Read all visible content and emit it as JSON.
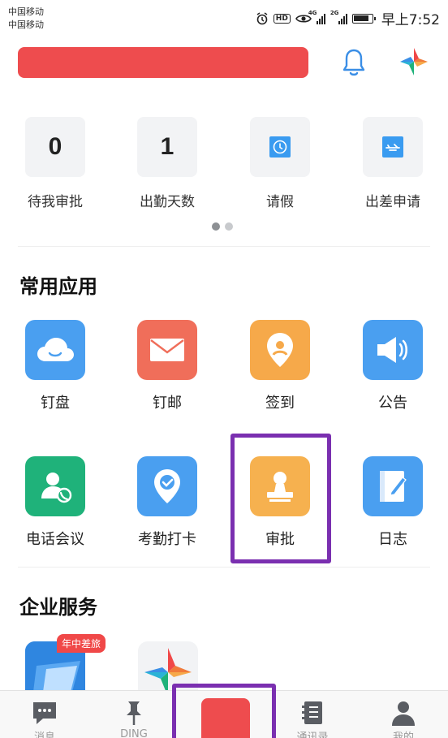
{
  "status_bar": {
    "carrier_1": "中国移动",
    "carrier_2": "中国移动",
    "hd_label": "HD",
    "net_1": "4G",
    "net_2": "2G",
    "time": "早上7:52"
  },
  "header": {
    "banner_color": "#ee4c4e",
    "bell_icon": "bell-icon",
    "logo_icon": "dingtalk-star-logo-icon"
  },
  "quick_stats": [
    {
      "value": "0",
      "label": "待我审批"
    },
    {
      "value": "1",
      "label": "出勤天数"
    },
    {
      "icon": "clock-icon",
      "label": "请假"
    },
    {
      "icon": "airplane-icon",
      "label": "出差申请"
    }
  ],
  "pager": {
    "total": 2,
    "active": 1
  },
  "common_apps": {
    "title": "常用应用",
    "items": [
      {
        "label": "钉盘",
        "icon": "cloud-icon",
        "color": "#4a9ff0"
      },
      {
        "label": "钉邮",
        "icon": "mail-icon",
        "color": "#f06e5a"
      },
      {
        "label": "签到",
        "icon": "location-pin-icon",
        "color": "#f6a94a"
      },
      {
        "label": "公告",
        "icon": "megaphone-icon",
        "color": "#4a9ff0"
      },
      {
        "label": "电话会议",
        "icon": "phone-user-icon",
        "color": "#1fb27a"
      },
      {
        "label": "考勤打卡",
        "icon": "check-pin-icon",
        "color": "#4a9ff0"
      },
      {
        "label": "审批",
        "icon": "stamp-icon",
        "color": "#f6b14f"
      },
      {
        "label": "日志",
        "icon": "notebook-pen-icon",
        "color": "#4a9ff0"
      }
    ]
  },
  "enterprise": {
    "title": "企业服务",
    "badge": "年中差旅"
  },
  "bottom_nav": [
    {
      "label": "消息",
      "icon": "chat-icon"
    },
    {
      "label": "DING",
      "icon": "pin-icon"
    },
    {
      "label": "",
      "icon": "work-redacted"
    },
    {
      "label": "通讯录",
      "icon": "contacts-icon"
    },
    {
      "label": "我的",
      "icon": "person-icon"
    }
  ],
  "accent_colors": {
    "highlight": "#7a2fb0",
    "red": "#ee4c4e"
  }
}
